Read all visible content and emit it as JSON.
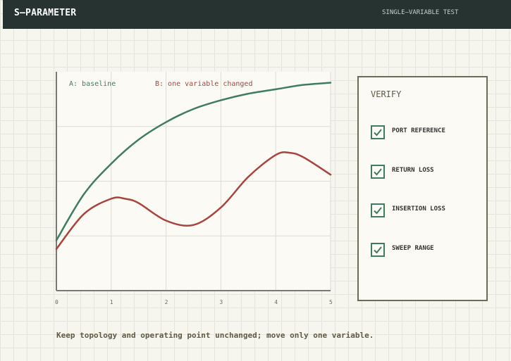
{
  "header": {
    "title": "S–PARAMETER",
    "subtitle": "SINGLE–VARIABLE TEST"
  },
  "chart_data": {
    "type": "line",
    "xlim": [
      0,
      5
    ],
    "ylim": [
      0,
      1
    ],
    "x_ticks": [
      "0",
      "1",
      "2",
      "3",
      "4",
      "5"
    ],
    "grid": true,
    "legend_position": "top-left",
    "series": [
      {
        "name": "A: baseline",
        "color": "#3f7d5e",
        "x": [
          0,
          0.5,
          1,
          1.5,
          2,
          2.5,
          3,
          3.5,
          4,
          4.5,
          5
        ],
        "y": [
          0.23,
          0.44,
          0.58,
          0.69,
          0.77,
          0.83,
          0.87,
          0.9,
          0.92,
          0.94,
          0.95
        ]
      },
      {
        "name": "B: one variable changed",
        "color": "#a8443d",
        "x": [
          0,
          0.5,
          1,
          1.25,
          1.5,
          2,
          2.5,
          3,
          3.5,
          4,
          4.25,
          4.5,
          5
        ],
        "y": [
          0.19,
          0.35,
          0.42,
          0.42,
          0.4,
          0.32,
          0.3,
          0.38,
          0.52,
          0.62,
          0.63,
          0.61,
          0.53
        ]
      }
    ]
  },
  "verify": {
    "title": "VERIFY",
    "items": [
      {
        "label": "PORT REFERENCE",
        "checked": true
      },
      {
        "label": "RETURN LOSS",
        "checked": true
      },
      {
        "label": "INSERTION LOSS",
        "checked": true
      },
      {
        "label": "SWEEP RANGE",
        "checked": true
      }
    ]
  },
  "footer": {
    "note": "Keep topology and operating point unchanged; move only one variable."
  }
}
